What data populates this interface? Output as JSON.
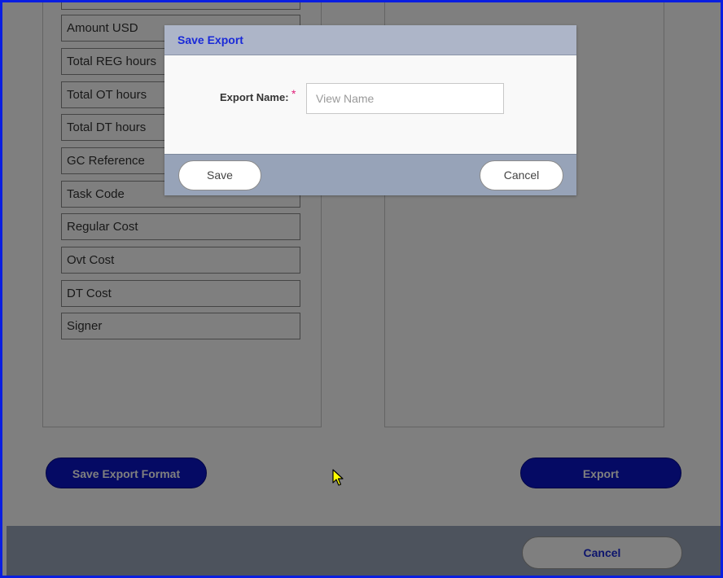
{
  "background": {
    "field_list": [
      {
        "label": "Amount USD"
      },
      {
        "label": "Total REG hours"
      },
      {
        "label": "Total OT hours"
      },
      {
        "label": "Total DT hours"
      },
      {
        "label": "GC Reference"
      },
      {
        "label": "Task Code"
      },
      {
        "label": "Regular Cost"
      },
      {
        "label": "Ovt Cost"
      },
      {
        "label": "DT Cost"
      },
      {
        "label": "Signer"
      }
    ],
    "save_export_format_label": "Save Export Format",
    "export_label": "Export",
    "footer_cancel_label": "Cancel"
  },
  "modal": {
    "title": "Save Export",
    "field_label": "Export Name:",
    "required_marker": "*",
    "input_value": "",
    "input_placeholder": "View Name",
    "save_label": "Save",
    "cancel_label": "Cancel"
  },
  "colors": {
    "accent_blue": "#0a14c8",
    "title_blue": "#1a2ad8",
    "required_pink": "#e0207a",
    "frame_blue": "#0a1ee0"
  }
}
